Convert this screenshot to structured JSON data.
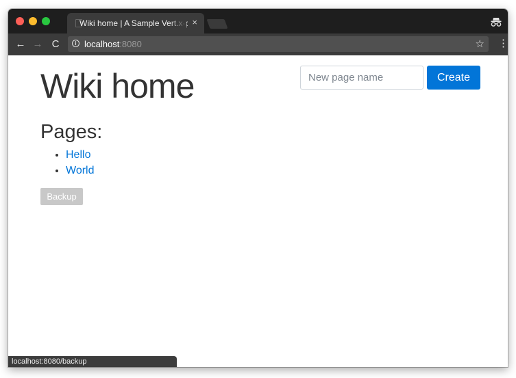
{
  "browser": {
    "tab_title": "Wiki home | A Sample Vert.x-p",
    "tab_close": "×",
    "url_host": "localhost",
    "url_port": ":8080",
    "back_glyph": "←",
    "forward_glyph": "→",
    "reload_glyph": "C",
    "info_glyph": "i",
    "star_glyph": "☆",
    "menu_glyph": "⋮",
    "status_text": "localhost:8080/backup"
  },
  "page": {
    "title": "Wiki home",
    "new_page_placeholder": "New page name",
    "new_page_value": "",
    "create_label": "Create",
    "pages_heading": "Pages:",
    "pages": [
      {
        "label": "Hello"
      },
      {
        "label": "World"
      }
    ],
    "backup_label": "Backup"
  },
  "colors": {
    "primary": "#0275d8",
    "link": "#0275d8",
    "backup_disabled": "#c8c8c8",
    "chrome_dark": "#1e1e1e",
    "toolbar": "#3b3b3b"
  },
  "icons": [
    "back-arrow-icon",
    "forward-arrow-icon",
    "reload-icon",
    "info-icon",
    "star-icon",
    "menu-icon",
    "incognito-icon",
    "close-icon",
    "page-icon"
  ]
}
